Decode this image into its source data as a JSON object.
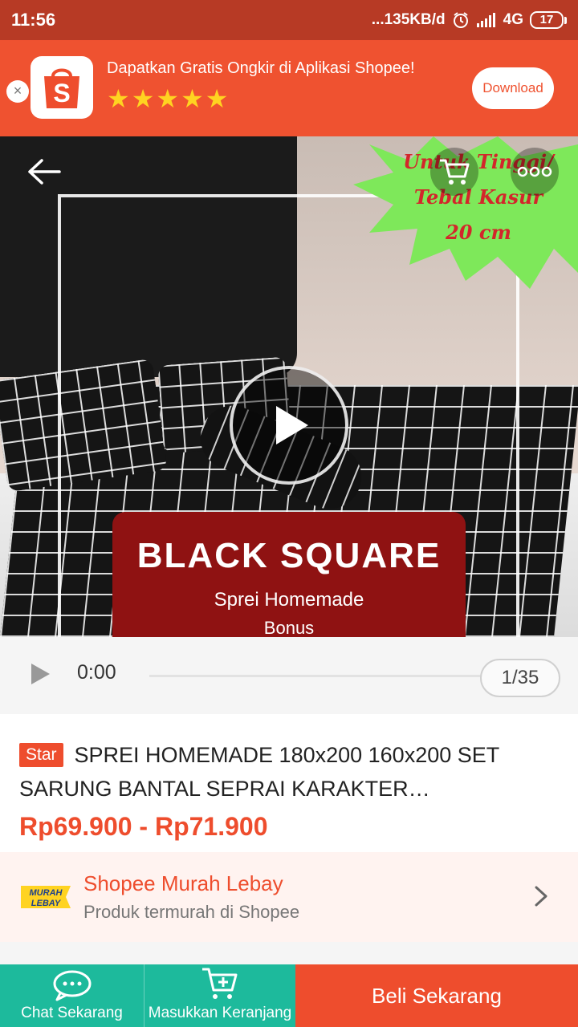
{
  "status_bar": {
    "time": "11:56",
    "network_speed": "...135KB/d",
    "network_type": "4G",
    "battery": "17"
  },
  "app_banner": {
    "title": "Dapatkan Gratis Ongkir di Aplikasi Shopee!",
    "rating_stars": 5,
    "download_label": "Download",
    "close_symbol": "×",
    "logo_letter": "S"
  },
  "product_image": {
    "burst_line1": "Untuk Tinggi/",
    "burst_line2": "Tebal Kasur",
    "burst_line3": "20 cm",
    "label_title": "BLACK SQUARE",
    "label_sub": "Sprei Homemade",
    "label_sub2": "Bonus"
  },
  "video": {
    "time": "0:00",
    "counter": "1/35"
  },
  "product": {
    "badge": "Star",
    "title": "SPREI HOMEMADE 180x200 160x200 SET SARUNG BANTAL SEPRAI KARAKTER…",
    "price": "Rp69.900 - Rp71.900"
  },
  "promo": {
    "title": "Shopee Murah Lebay",
    "subtitle": "Produk termurah di Shopee",
    "logo_text_top": "MURAH",
    "logo_text_bottom": "LEBAY"
  },
  "bottom_bar": {
    "chat_label": "Chat Sekarang",
    "cart_label": "Masukkan Keranjang",
    "buy_label": "Beli Sekarang"
  },
  "colors": {
    "brand_orange": "#ee4d2d",
    "status_bar": "#b73a25",
    "teal": "#1dba9c"
  }
}
